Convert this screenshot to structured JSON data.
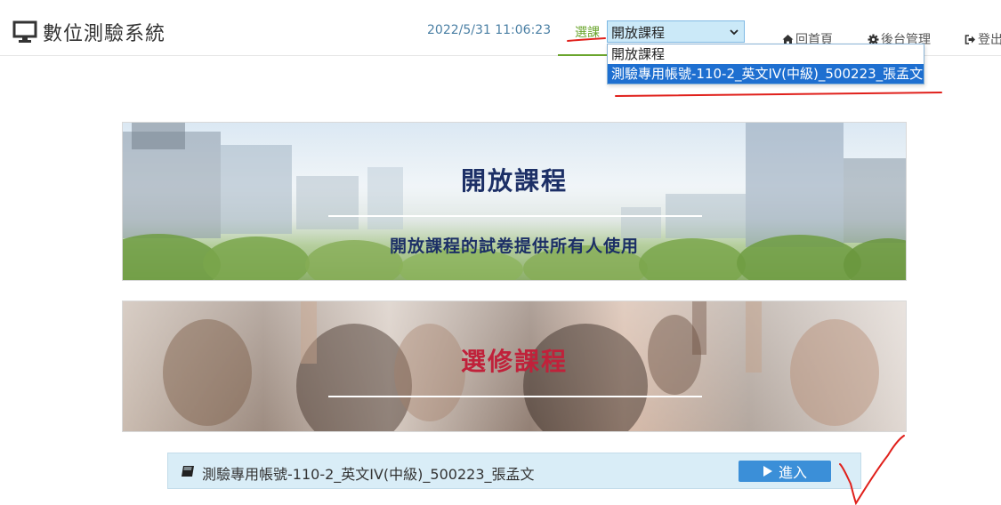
{
  "header": {
    "title": "數位測驗系統",
    "datetime": "2022/5/31 11:06:23",
    "course_label": "選課",
    "course_select": {
      "selected": "開放課程",
      "options": [
        "開放課程",
        "測驗專用帳號-110-2_英文IV(中級)_500223_張孟文"
      ],
      "highlighted_option": "測驗專用帳號-110-2_英文IV(中級)_500223_張孟文"
    },
    "nav": {
      "home": "回首頁",
      "admin": "後台管理",
      "logout": "登出"
    }
  },
  "banners": {
    "open_course": {
      "title": "開放課程",
      "subtitle": "開放課程的試卷提供所有人使用"
    },
    "elective_course": {
      "title": "選修課程"
    }
  },
  "course_list": [
    {
      "name": "測驗專用帳號-110-2_英文IV(中級)_500223_張孟文",
      "enter_label": "進入"
    }
  ],
  "colors": {
    "accent_green": "#6aa52d",
    "datetime_blue": "#4a7fa4",
    "select_bg": "#cbe9f8",
    "option_highlight": "#1e6fd0",
    "open_title": "#1c2f66",
    "elective_title": "#c0213a",
    "course_row_bg": "#d9edf7",
    "enter_button": "#3b8fd8",
    "annotation_red": "#e0201b"
  },
  "icons": {
    "logo": "monitor-icon",
    "home": "home-icon",
    "admin": "gear-icon",
    "logout": "sign-out-icon",
    "course": "book-icon",
    "enter": "play-icon"
  }
}
